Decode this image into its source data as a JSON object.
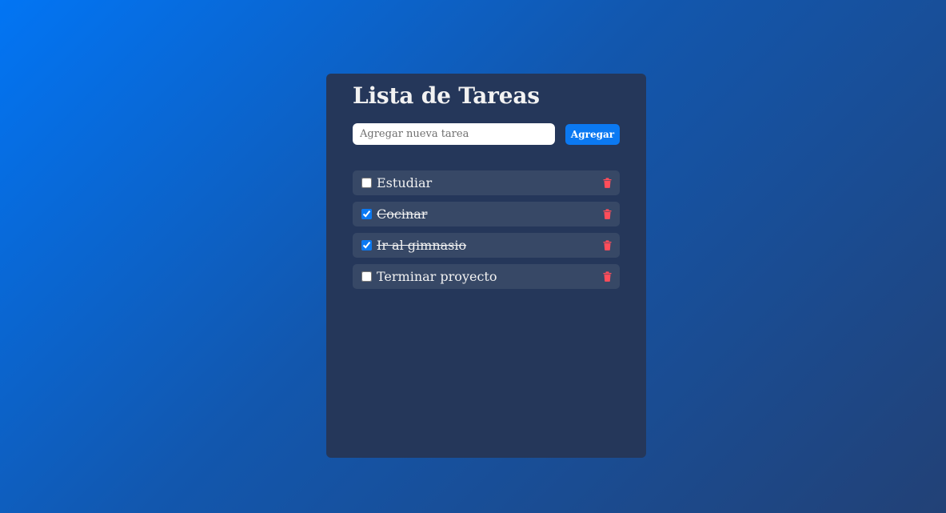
{
  "colors": {
    "background_start": "#0275f4",
    "background_end": "#224176",
    "card": "#25375a",
    "task_row": "#374866",
    "accent": "#0b79f2",
    "delete": "#ff4d5a"
  },
  "app": {
    "title": "Lista de Tareas"
  },
  "form": {
    "input_value": "",
    "input_placeholder": "Agregar nueva tarea",
    "add_label": "Agregar"
  },
  "tasks": [
    {
      "text": "Estudiar",
      "completed": false,
      "delete_icon": "trash-icon"
    },
    {
      "text": "Cocinar",
      "completed": true,
      "delete_icon": "trash-icon"
    },
    {
      "text": "Ir al gimnasio",
      "completed": true,
      "delete_icon": "trash-icon"
    },
    {
      "text": "Terminar proyecto",
      "completed": false,
      "delete_icon": "trash-icon"
    }
  ]
}
